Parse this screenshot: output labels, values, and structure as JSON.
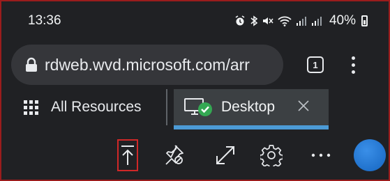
{
  "status_bar": {
    "time": "13:36",
    "battery_percent": "40%",
    "icons": [
      "alarm-icon",
      "bluetooth-icon",
      "mute-icon",
      "wifi-icon",
      "signal-icon",
      "signal-icon",
      "battery-icon"
    ]
  },
  "browser": {
    "url": "rdweb.wvd.microsoft.com/arr",
    "tab_count": "1"
  },
  "tabs": {
    "all_resources_label": "All Resources",
    "desktop_label": "Desktop"
  },
  "colors": {
    "background": "#202124",
    "active_tab_underline": "#4c9bd6",
    "check_badge": "#34a853",
    "avatar": "#1e74d8",
    "highlight_border": "#d02828"
  }
}
